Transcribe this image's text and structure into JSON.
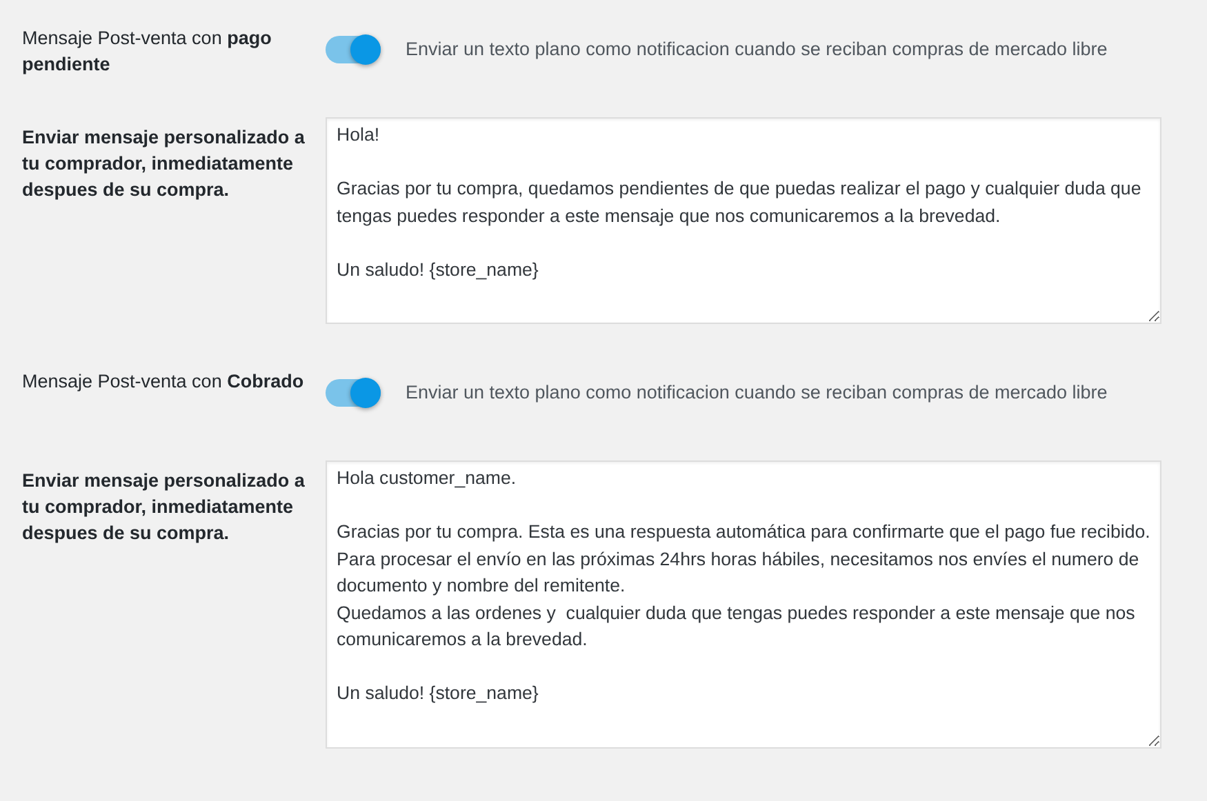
{
  "settings": [
    {
      "kind": "toggle",
      "label": "Mensaje Post-venta con **pago pendiente**",
      "on": true,
      "description": "Enviar un texto plano como notificacion cuando se reciban compras de mercado libre"
    },
    {
      "kind": "textarea",
      "label": "Enviar mensaje personalizado a tu comprador, inmediatamente despues de su compra.",
      "value": "Hola!\n\nGracias por tu compra, quedamos pendientes de que puedas realizar el pago y cualquier duda que tengas puedes responder a este mensaje que nos comunicaremos a la brevedad.\n\nUn saludo! {store_name}"
    },
    {
      "kind": "toggle",
      "label": "Mensaje Post-venta con **Cobrado**",
      "on": true,
      "description": "Enviar un texto plano como notificacion cuando se reciban compras de mercado libre"
    },
    {
      "kind": "textarea",
      "label": "Enviar mensaje personalizado a tu comprador, inmediatamente despues de su compra.",
      "value": "Hola customer_name.\n\nGracias por tu compra. Esta es una respuesta automática para confirmarte que el pago fue recibido. Para procesar el envío en las próximas 24hrs horas hábiles, necesitamos nos envíes el numero de documento y nombre del remitente.\nQuedamos a las ordenes y  cualquier duda que tengas puedes responder a este mensaje que nos comunicaremos a la brevedad.\n\nUn saludo! {store_name}"
    }
  ]
}
